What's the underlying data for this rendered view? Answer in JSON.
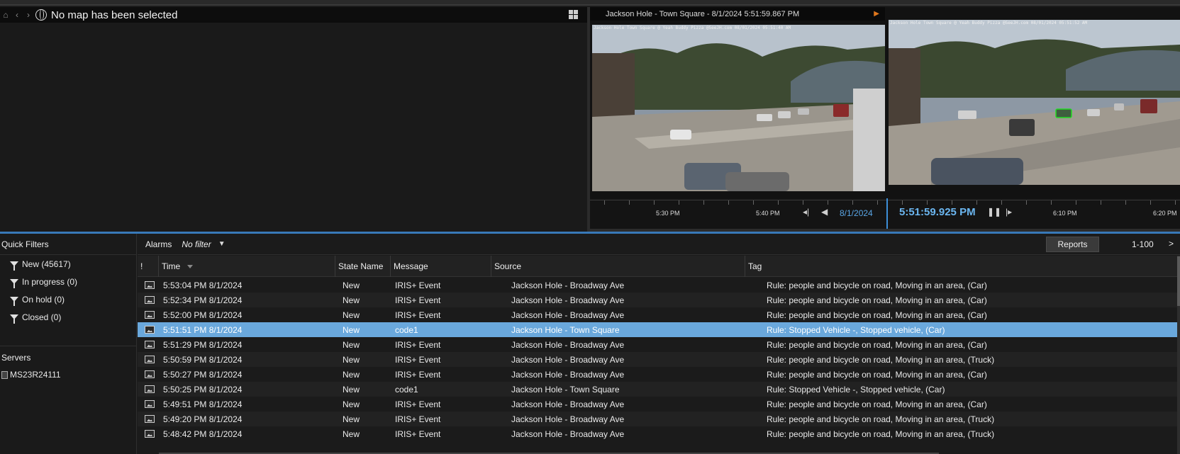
{
  "map": {
    "title": "No map has been selected"
  },
  "cameras": [
    {
      "header": "Jackson Hole - Town Square - 8/1/2024 5:51:59.867 PM",
      "overlay": "Jackson Hole Town Square @ Yeah Buddy Pizza @SeeJH.com 08/01/2024 05:51:40 AM"
    },
    {
      "header": "",
      "overlay": "Jackson Hole Town Square @ Yeah Buddy Pizza @SeeJH.com 08/01/2024 05:51:52 AM"
    }
  ],
  "timeline": {
    "labels": [
      "5:30 PM",
      "5:40 PM",
      "6:10 PM",
      "6:20 PM"
    ],
    "date": "8/1/2024",
    "current_time": "5:51:59.925 PM"
  },
  "sidebar": {
    "quick_filters_title": "Quick Filters",
    "filters": [
      "New (45617)",
      "In progress (0)",
      "On hold (0)",
      "Closed (0)"
    ],
    "servers_title": "Servers",
    "server": "MS23R24111"
  },
  "alarms": {
    "label": "Alarms",
    "filter": "No filter",
    "reports_button": "Reports",
    "range": "1-100",
    "next": ">",
    "columns": [
      "!",
      "Time",
      "State Name",
      "Message",
      "Source",
      "Tag"
    ],
    "rows": [
      {
        "time": "5:53:04 PM 8/1/2024",
        "state": "New",
        "message": "IRIS+ Event",
        "source": "Jackson Hole - Broadway Ave",
        "tag": "Rule: people and bicycle on road, Moving in an area, (Car)"
      },
      {
        "time": "5:52:34 PM 8/1/2024",
        "state": "New",
        "message": "IRIS+ Event",
        "source": "Jackson Hole - Broadway Ave",
        "tag": "Rule: people and bicycle on road, Moving in an area, (Car)"
      },
      {
        "time": "5:52:00 PM 8/1/2024",
        "state": "New",
        "message": "IRIS+ Event",
        "source": "Jackson Hole - Broadway Ave",
        "tag": "Rule: people and bicycle on road, Moving in an area, (Car)"
      },
      {
        "time": "5:51:51 PM 8/1/2024",
        "state": "New",
        "message": "code1",
        "source": "Jackson Hole - Town Square",
        "tag": "Rule: Stopped Vehicle -, Stopped vehicle, (Car)"
      },
      {
        "time": "5:51:29 PM 8/1/2024",
        "state": "New",
        "message": "IRIS+ Event",
        "source": "Jackson Hole - Broadway Ave",
        "tag": "Rule: people and bicycle on road, Moving in an area, (Car)"
      },
      {
        "time": "5:50:59 PM 8/1/2024",
        "state": "New",
        "message": "IRIS+ Event",
        "source": "Jackson Hole - Broadway Ave",
        "tag": "Rule: people and bicycle on road, Moving in an area, (Truck)"
      },
      {
        "time": "5:50:27 PM 8/1/2024",
        "state": "New",
        "message": "IRIS+ Event",
        "source": "Jackson Hole - Broadway Ave",
        "tag": "Rule: people and bicycle on road, Moving in an area, (Car)"
      },
      {
        "time": "5:50:25 PM 8/1/2024",
        "state": "New",
        "message": "code1",
        "source": "Jackson Hole - Town Square",
        "tag": "Rule: Stopped Vehicle -, Stopped vehicle, (Car)"
      },
      {
        "time": "5:49:51 PM 8/1/2024",
        "state": "New",
        "message": "IRIS+ Event",
        "source": "Jackson Hole - Broadway Ave",
        "tag": "Rule: people and bicycle on road, Moving in an area, (Car)"
      },
      {
        "time": "5:49:20 PM 8/1/2024",
        "state": "New",
        "message": "IRIS+ Event",
        "source": "Jackson Hole - Broadway Ave",
        "tag": "Rule: people and bicycle on road, Moving in an area, (Truck)"
      },
      {
        "time": "5:48:42 PM 8/1/2024",
        "state": "New",
        "message": "IRIS+ Event",
        "source": "Jackson Hole - Broadway Ave",
        "tag": "Rule: people and bicycle on road, Moving in an area, (Truck)"
      }
    ],
    "selected_row": 3
  },
  "colors": {
    "accent": "#3d8fd8",
    "selected_row": "#6aa8dc",
    "recording": "#e0771d"
  },
  "icons": [
    "home-icon",
    "back-icon",
    "forward-icon",
    "globe-icon",
    "layout-grid-icon",
    "record-icon",
    "step-back-icon",
    "play-reverse-icon",
    "pause-icon",
    "step-forward-icon",
    "filter-icon",
    "server-icon",
    "snapshot-icon",
    "sort-desc-icon",
    "chevron-down-icon"
  ]
}
